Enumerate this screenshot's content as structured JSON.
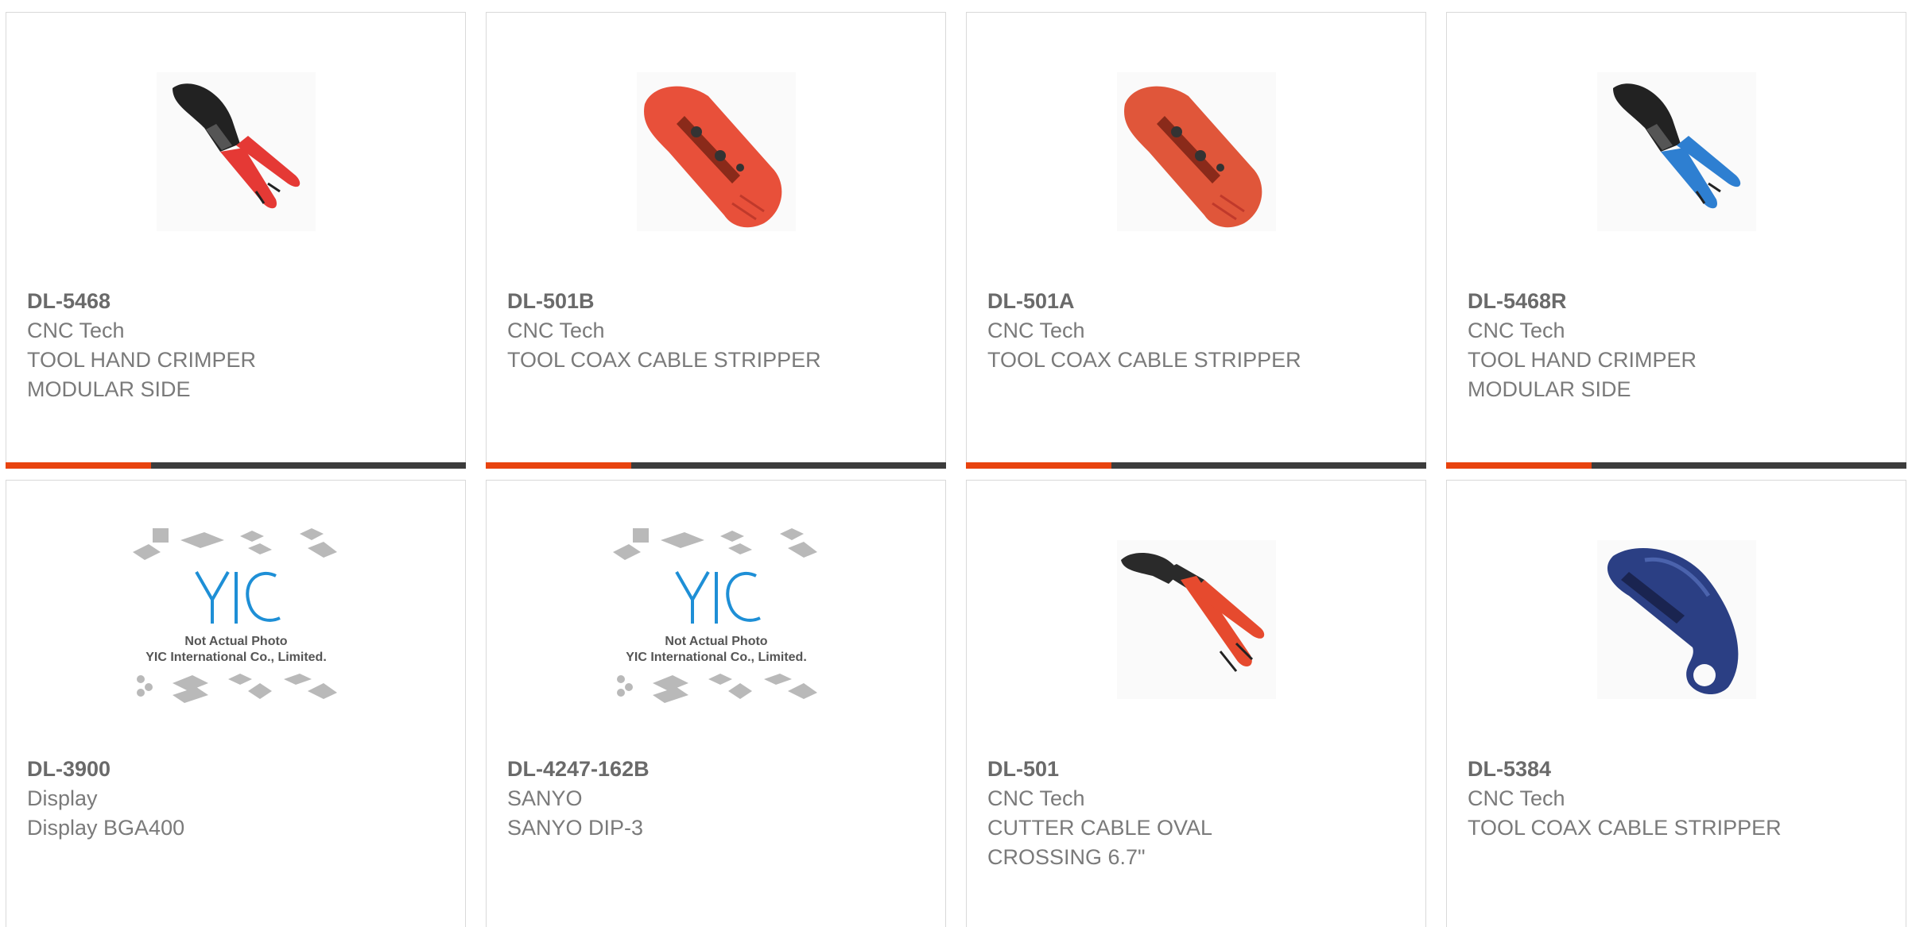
{
  "colors": {
    "accent": "#e8430f",
    "bar_dark": "#3c3c3c",
    "border": "#d9d9d9",
    "text": "#7a7a7a"
  },
  "products": [
    {
      "part": "DL-5468",
      "brand": "CNC Tech",
      "desc1": "TOOL HAND CRIMPER",
      "desc2": "MODULAR SIDE",
      "image": "crimper-red-icon"
    },
    {
      "part": "DL-501B",
      "brand": "CNC Tech",
      "desc1": "TOOL COAX CABLE STRIPPER",
      "desc2": "",
      "image": "coax-stripper-red-icon"
    },
    {
      "part": "DL-501A",
      "brand": "CNC Tech",
      "desc1": "TOOL COAX CABLE STRIPPER",
      "desc2": "",
      "image": "coax-stripper-red-icon"
    },
    {
      "part": "DL-5468R",
      "brand": "CNC Tech",
      "desc1": "TOOL HAND CRIMPER",
      "desc2": "MODULAR SIDE",
      "image": "crimper-blue-icon"
    },
    {
      "part": "DL-3900",
      "brand": "Display",
      "desc1": "Display BGA400",
      "desc2": "",
      "image": "placeholder-photo"
    },
    {
      "part": "DL-4247-162B",
      "brand": "SANYO",
      "desc1": "SANYO DIP-3",
      "desc2": "",
      "image": "placeholder-photo"
    },
    {
      "part": "DL-501",
      "brand": "CNC Tech",
      "desc1": "CUTTER CABLE OVAL",
      "desc2": "CROSSING 6.7\"",
      "image": "cable-cutter-icon"
    },
    {
      "part": "DL-5384",
      "brand": "CNC Tech",
      "desc1": "TOOL COAX CABLE STRIPPER",
      "desc2": "",
      "image": "coax-stripper-blue-icon"
    }
  ],
  "placeholder": {
    "logo": "YIC",
    "line1": "Not Actual Photo",
    "line2": "YIC International Co., Limited."
  }
}
